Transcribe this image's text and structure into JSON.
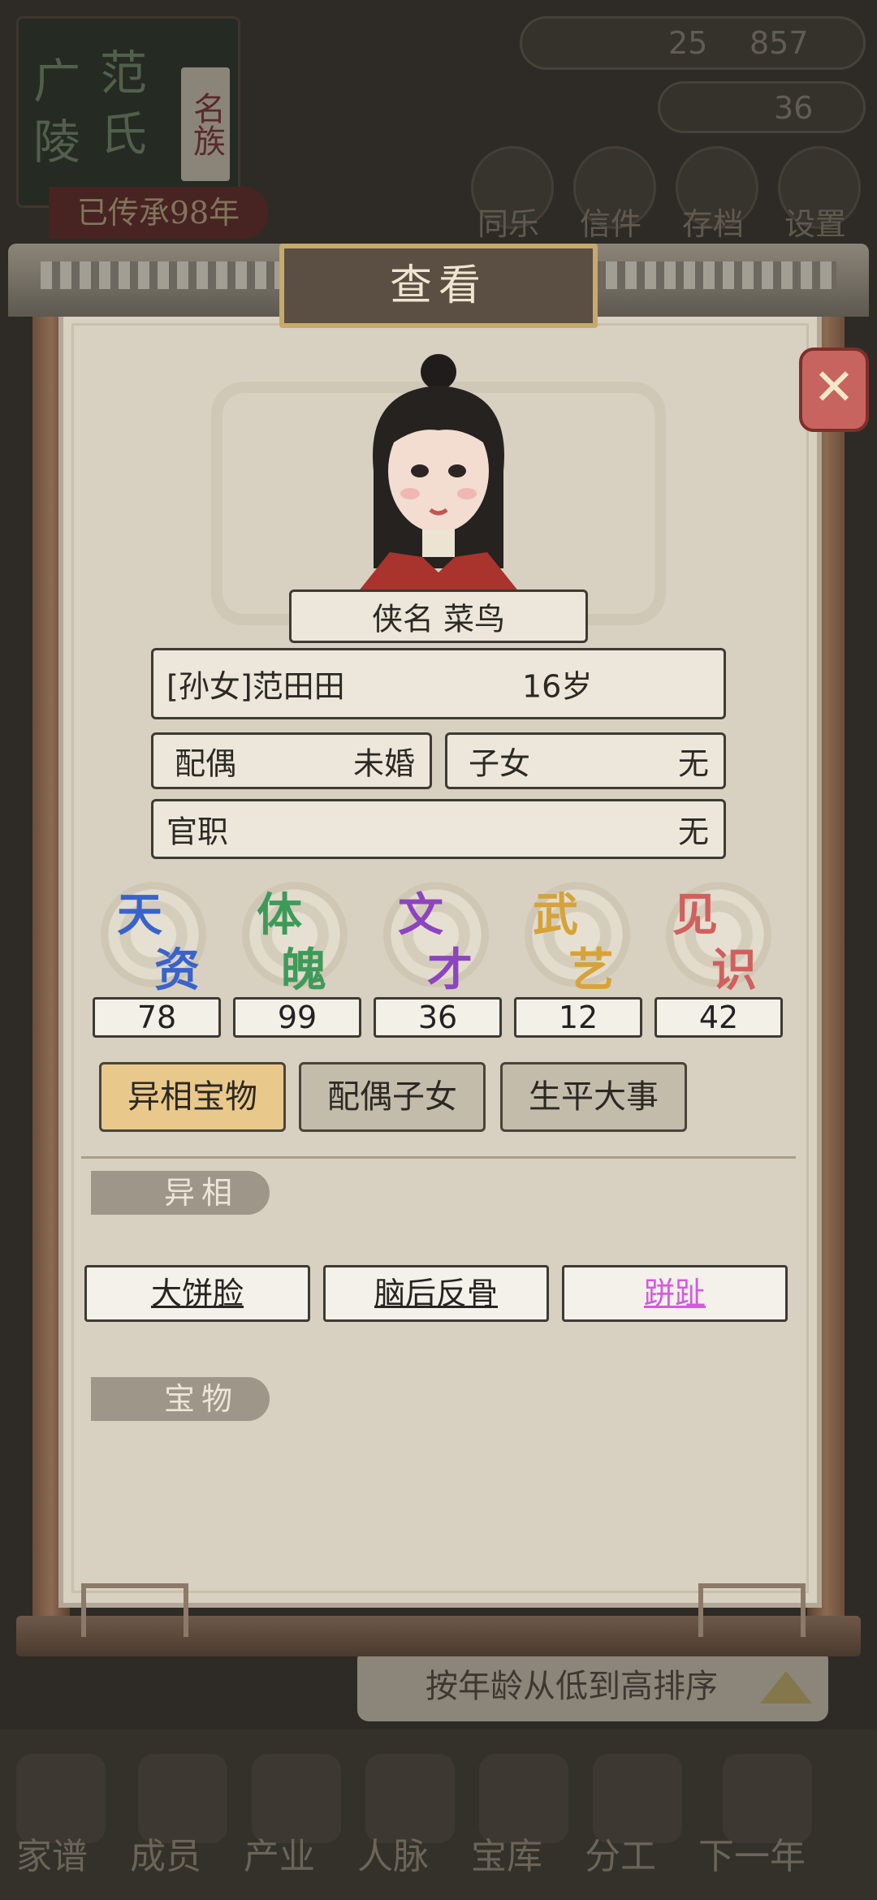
{
  "background": {
    "clan": {
      "chars_left": [
        "广",
        "陵"
      ],
      "chars_mid": [
        "范",
        "氏"
      ],
      "badge": "名族",
      "banner": "已传承98年"
    },
    "resources": {
      "coins_left": "25",
      "coins_right": "857",
      "gold": "36"
    },
    "top_menu": [
      "同乐",
      "信件",
      "存档",
      "设置"
    ],
    "sort_label": "按年龄从低到高排序",
    "bottom_nav": [
      "家谱",
      "成员",
      "产业",
      "人脉",
      "宝库",
      "分工",
      "下一年"
    ]
  },
  "dialog": {
    "title": "查看",
    "close_icon": "close-icon",
    "alias": "侠名  菜鸟",
    "identity": "[孙女]范田田",
    "age": "16岁",
    "spouse_label": "配偶",
    "spouse_value": "未婚",
    "children_label": "子女",
    "children_value": "无",
    "office_label": "官职",
    "office_value": "无",
    "stats": [
      {
        "label_top": "天",
        "label_bottom": "资",
        "value": "78",
        "color": "#3a63c9"
      },
      {
        "label_top": "体",
        "label_bottom": "魄",
        "value": "99",
        "color": "#3f9a5a"
      },
      {
        "label_top": "文",
        "label_bottom": "才",
        "value": "36",
        "color": "#8d44c0"
      },
      {
        "label_top": "武",
        "label_bottom": "艺",
        "value": "12",
        "color": "#d6a23a"
      },
      {
        "label_top": "见",
        "label_bottom": "识",
        "value": "42",
        "color": "#d0605e"
      }
    ],
    "tabs": [
      "异相宝物",
      "配偶子女",
      "生平大事"
    ],
    "section_traits": "异相",
    "traits": [
      {
        "label": "大饼脸",
        "color": "#262320"
      },
      {
        "label": "脑后反骨",
        "color": "#262320"
      },
      {
        "label": "跰趾",
        "color": "#d45ae0"
      }
    ],
    "section_treasures": "宝物"
  }
}
